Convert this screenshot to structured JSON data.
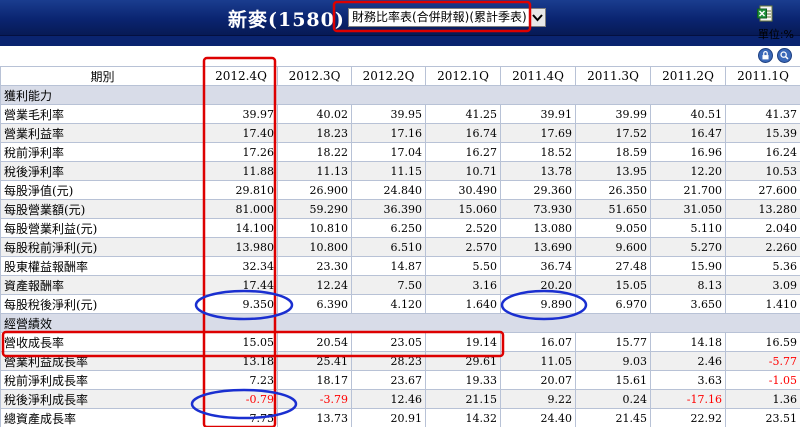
{
  "header": {
    "title": "新麥(1580)",
    "report_select": "財務比率表(合併財報)(累計季表)",
    "unit_label": "單位:%"
  },
  "table": {
    "row_header": "期別",
    "periods": [
      "2012.4Q",
      "2012.3Q",
      "2012.2Q",
      "2012.1Q",
      "2011.4Q",
      "2011.3Q",
      "2011.2Q",
      "2011.1Q"
    ],
    "sections": [
      {
        "title": "獲利能力",
        "rows": [
          {
            "label": "營業毛利率",
            "values": [
              "39.97",
              "40.02",
              "39.95",
              "41.25",
              "39.91",
              "39.99",
              "40.51",
              "41.37"
            ]
          },
          {
            "label": "營業利益率",
            "values": [
              "17.40",
              "18.23",
              "17.16",
              "16.74",
              "17.69",
              "17.52",
              "16.47",
              "15.39"
            ]
          },
          {
            "label": "稅前淨利率",
            "values": [
              "17.26",
              "18.22",
              "17.04",
              "16.27",
              "18.52",
              "18.59",
              "16.96",
              "16.24"
            ]
          },
          {
            "label": "稅後淨利率",
            "values": [
              "11.88",
              "11.13",
              "11.15",
              "10.71",
              "13.78",
              "13.95",
              "12.20",
              "10.53"
            ]
          },
          {
            "label": "每股淨值(元)",
            "values": [
              "29.810",
              "26.900",
              "24.840",
              "30.490",
              "29.360",
              "26.350",
              "21.700",
              "27.600"
            ]
          },
          {
            "label": "每股營業額(元)",
            "values": [
              "81.000",
              "59.290",
              "36.390",
              "15.060",
              "73.930",
              "51.650",
              "31.050",
              "13.280"
            ]
          },
          {
            "label": "每股營業利益(元)",
            "values": [
              "14.100",
              "10.810",
              "6.250",
              "2.520",
              "13.080",
              "9.050",
              "5.110",
              "2.040"
            ]
          },
          {
            "label": "每股稅前淨利(元)",
            "values": [
              "13.980",
              "10.800",
              "6.510",
              "2.570",
              "13.690",
              "9.600",
              "5.270",
              "2.260"
            ]
          },
          {
            "label": "股東權益報酬率",
            "values": [
              "32.34",
              "23.30",
              "14.87",
              "5.50",
              "36.74",
              "27.48",
              "15.90",
              "5.36"
            ]
          },
          {
            "label": "資產報酬率",
            "values": [
              "17.44",
              "12.24",
              "7.50",
              "3.16",
              "20.20",
              "15.05",
              "8.13",
              "3.09"
            ]
          },
          {
            "label": "每股稅後淨利(元)",
            "values": [
              "9.350",
              "6.390",
              "4.120",
              "1.640",
              "9.890",
              "6.970",
              "3.650",
              "1.410"
            ]
          }
        ]
      },
      {
        "title": "經營績效",
        "rows": [
          {
            "label": "營收成長率",
            "values": [
              "15.05",
              "20.54",
              "23.05",
              "19.14",
              "16.07",
              "15.77",
              "14.18",
              "16.59"
            ]
          },
          {
            "label": "營業利益成長率",
            "values": [
              "13.18",
              "25.41",
              "28.23",
              "29.61",
              "11.05",
              "9.03",
              "2.46",
              "-5.77"
            ]
          },
          {
            "label": "稅前淨利成長率",
            "values": [
              "7.23",
              "18.17",
              "23.67",
              "19.33",
              "20.07",
              "15.61",
              "3.63",
              "-1.05"
            ]
          },
          {
            "label": "稅後淨利成長率",
            "values": [
              "-0.79",
              "-3.79",
              "12.46",
              "21.15",
              "9.22",
              "0.24",
              "-17.16",
              "1.36"
            ]
          },
          {
            "label": "總資產成長率",
            "values": [
              "7.75",
              "13.73",
              "20.91",
              "14.32",
              "24.40",
              "21.45",
              "22.92",
              "23.51"
            ]
          }
        ]
      }
    ]
  },
  "colors": {
    "header_bg": "#0a2470",
    "negative_text": "#ff0000",
    "annotation": "#dd0000",
    "annotation_oval": "#1a2fd0"
  },
  "icons": {
    "excel_export": "excel-export-icon",
    "lock": "lock-icon",
    "zoom": "magnifier-icon",
    "dropdown": "chevron-down-icon"
  }
}
